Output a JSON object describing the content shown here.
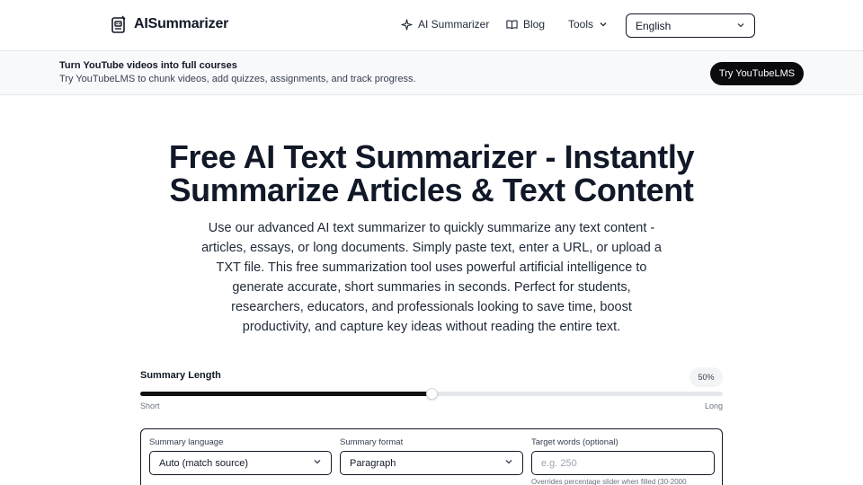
{
  "header": {
    "logo_text": "AISummarizer",
    "nav": {
      "ai_summarizer": "AI Summarizer",
      "blog": "Blog",
      "tools": "Tools"
    },
    "language_selected": "English"
  },
  "banner": {
    "title": "Turn YouTube videos into full courses",
    "subtitle": "Try YouTubeLMS to chunk videos, add quizzes, assignments, and track progress.",
    "button_label": "Try YouTubeLMS"
  },
  "hero": {
    "title_line1": "Free AI Text Summarizer - Instantly",
    "title_line2": "Summarize Articles & Text Content",
    "description": "Use our advanced AI text summarizer to quickly summarize any text content - articles, essays, or long documents. Simply paste text, enter a URL, or upload a TXT file. This free summarization tool uses powerful artificial intelligence to generate accurate, short summaries in seconds. Perfect for students, researchers, educators, and professionals looking to save time, boost productivity, and capture key ideas without reading the entire text."
  },
  "summary_length": {
    "label": "Summary Length",
    "percent_label": "50%",
    "value": 0.5,
    "min_label": "Short",
    "max_label": "Long"
  },
  "options": {
    "language": {
      "label": "Summary language",
      "value": "Auto (match source)"
    },
    "format": {
      "label": "Summary format",
      "value": "Paragraph"
    },
    "target_words": {
      "label": "Target words (optional)",
      "placeholder": "e.g. 250",
      "hint": "Overrides percentage slider when filled (30-2000"
    }
  },
  "colors": {
    "accent_dark": "#0b0b0f",
    "banner_bg": "#f8f9fb",
    "border": "#111827"
  }
}
